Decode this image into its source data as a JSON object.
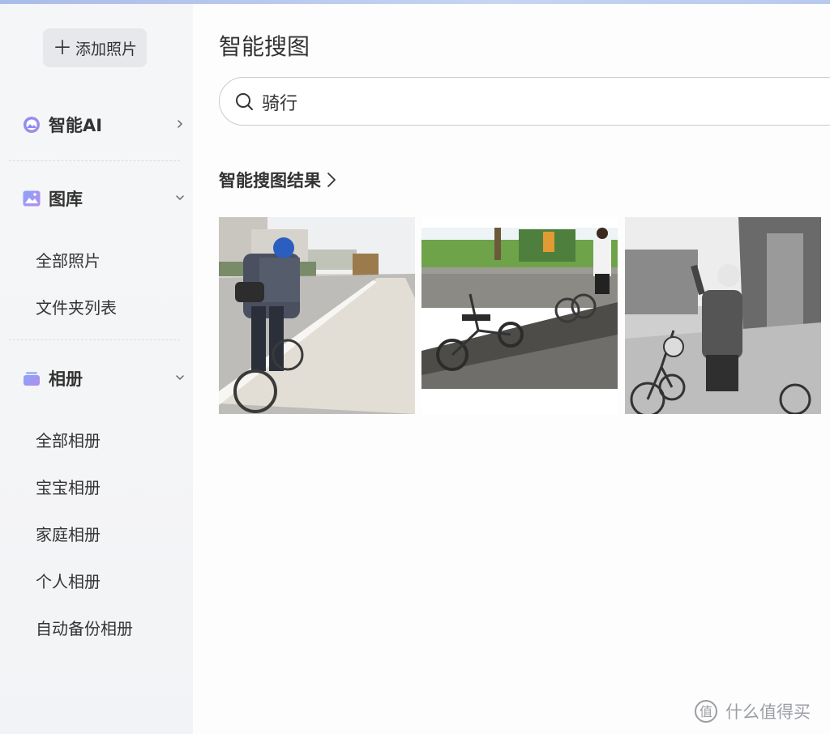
{
  "sidebar": {
    "add_button": "添加照片",
    "groups": [
      {
        "label": "智能AI",
        "icon": "ai-icon",
        "chevron": "chevron-right-icon"
      },
      {
        "label": "图库",
        "icon": "gallery-icon",
        "chevron": "chevron-down-icon",
        "items": [
          "全部照片",
          "文件夹列表"
        ]
      },
      {
        "label": "相册",
        "icon": "album-icon",
        "chevron": "chevron-down-icon",
        "items": [
          "全部相册",
          "宝宝相册",
          "家庭相册",
          "个人相册",
          "自动备份相册"
        ]
      }
    ]
  },
  "main": {
    "title": "智能搜图",
    "search": {
      "value": "骑行",
      "icon": "search-icon"
    },
    "results_title": "智能搜图结果",
    "photos": [
      {
        "icon": "photo-cyclist-road"
      },
      {
        "icon": "photo-folding-bikes"
      },
      {
        "icon": "photo-bw-person-with-bike"
      }
    ]
  },
  "watermark": {
    "text": "什么值得买"
  },
  "colors": {
    "accent": "#7b7ff0",
    "sidebar_bg": "#f4f5f7",
    "page_bg": "#fdfdfe"
  }
}
